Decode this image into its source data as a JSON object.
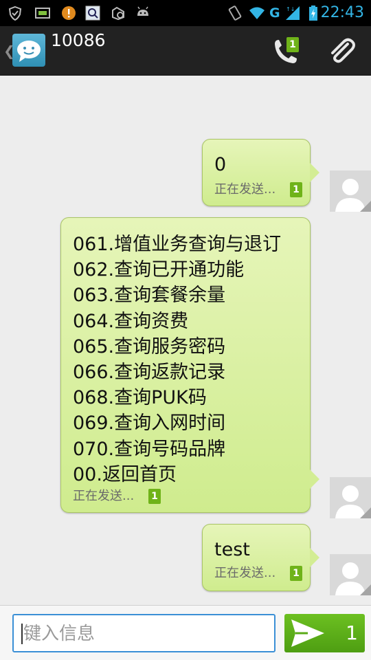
{
  "status_bar": {
    "time": "22:43",
    "network": "G",
    "icons": [
      "shield-icon",
      "sim-icon",
      "alert-icon",
      "search-app-icon",
      "settings-check-icon",
      "android-icon",
      "vibrate-icon",
      "wifi-icon",
      "signal-icon",
      "battery-charging-icon"
    ],
    "accent_color": "#33b5e5"
  },
  "header": {
    "contact": "10086",
    "call_badge": "1",
    "icons": [
      "back-chevron-icon",
      "messaging-app-icon",
      "phone-icon",
      "paperclip-icon"
    ]
  },
  "messages": [
    {
      "lines": [
        "0"
      ],
      "status": "正在发送...",
      "sim": "1"
    },
    {
      "lines": [
        "061.增值业务查询与退订",
        "062.查询已开通功能",
        "063.查询套餐余量",
        "064.查询资费",
        "065.查询服务密码",
        "066.查询返款记录",
        "068.查询PUK码",
        "069.查询入网时间",
        "070.查询号码品牌",
        "00.返回首页"
      ],
      "status": "正在发送...",
      "sim": "1"
    },
    {
      "lines": [
        "test"
      ],
      "status": "正在发送...",
      "sim": "1"
    }
  ],
  "compose": {
    "placeholder": "键入信息",
    "send_count": "1",
    "send_color": "#5aab17"
  }
}
